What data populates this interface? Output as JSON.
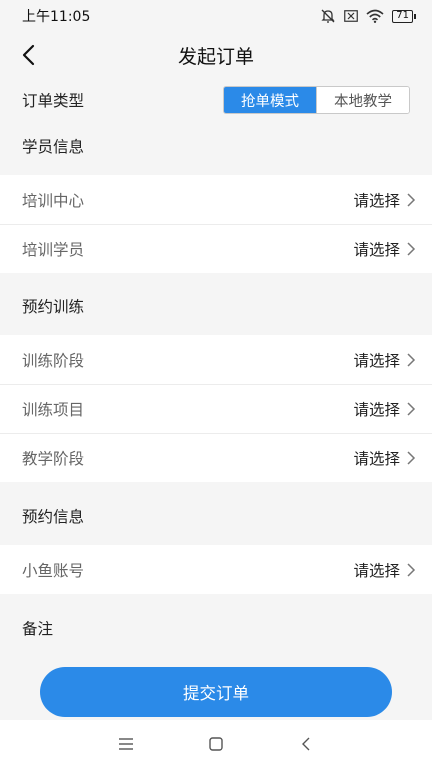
{
  "status_bar": {
    "time": "上午11:05",
    "battery": "71",
    "icons": [
      "mute-icon",
      "sim-card-icon",
      "wifi-icon",
      "battery-icon"
    ]
  },
  "header": {
    "title": "发起订单",
    "back_icon": "back-arrow-icon"
  },
  "order_type": {
    "label": "订单类型",
    "options": [
      "抢单模式",
      "本地教学"
    ],
    "selected": "抢单模式"
  },
  "sections": {
    "student_info": {
      "title": "学员信息",
      "rows": [
        {
          "label": "培训中心",
          "value": "请选择"
        },
        {
          "label": "培训学员",
          "value": "请选择"
        }
      ]
    },
    "training": {
      "title": "预约训练",
      "rows": [
        {
          "label": "训练阶段",
          "value": "请选择"
        },
        {
          "label": "训练项目",
          "value": "请选择"
        },
        {
          "label": "教学阶段",
          "value": "请选择"
        }
      ]
    },
    "booking_info": {
      "title": "预约信息",
      "rows": [
        {
          "label": "小鱼账号",
          "value": "请选择"
        }
      ]
    },
    "remark": {
      "title": "备注"
    }
  },
  "submit": {
    "label": "提交订单"
  },
  "colors": {
    "accent": "#2b8ae8",
    "background": "#f5f5f5"
  },
  "nav_bar": {
    "icons": [
      "menu-icon",
      "home-icon",
      "back-icon"
    ]
  }
}
